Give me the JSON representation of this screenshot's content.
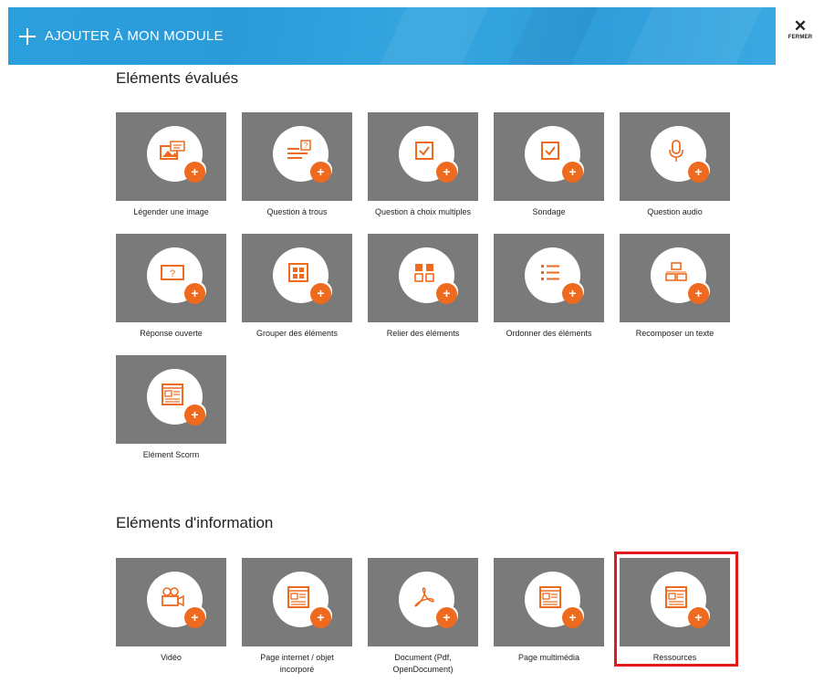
{
  "header": {
    "title": "AJOUTER À MON MODULE"
  },
  "close": {
    "icon": "✕",
    "label": "FERMER"
  },
  "sections": {
    "evaluated": {
      "title": "Eléments évalués",
      "items": [
        {
          "label": "Légender une image",
          "icon": "image-caption-icon"
        },
        {
          "label": "Question à trous",
          "icon": "fill-blank-icon"
        },
        {
          "label": "Question à choix multiples",
          "icon": "checkbox-icon"
        },
        {
          "label": "Sondage",
          "icon": "survey-icon"
        },
        {
          "label": "Question audio",
          "icon": "microphone-icon"
        },
        {
          "label": "Réponse ouverte",
          "icon": "open-answer-icon"
        },
        {
          "label": "Grouper des éléments",
          "icon": "group-icon"
        },
        {
          "label": "Relier des éléments",
          "icon": "link-elements-icon"
        },
        {
          "label": "Ordonner des éléments",
          "icon": "ordered-list-icon"
        },
        {
          "label": "Recomposer un texte",
          "icon": "recompose-text-icon"
        },
        {
          "label": "Elément Scorm",
          "icon": "scorm-icon"
        }
      ]
    },
    "information": {
      "title": "Eléments d'information",
      "items": [
        {
          "label": "Vidéo",
          "icon": "video-camera-icon"
        },
        {
          "label": "Page internet / objet incorporé",
          "icon": "web-page-icon"
        },
        {
          "label": "Document (Pdf, OpenDocument)",
          "icon": "pdf-icon"
        },
        {
          "label": "Page multimédia",
          "icon": "multimedia-page-icon"
        },
        {
          "label": "Ressources",
          "icon": "resources-icon"
        }
      ]
    }
  },
  "badge": "+",
  "colors": {
    "header": "#2b9fdc",
    "tile": "#7a7a7a",
    "accent": "#ee6a1f",
    "selection": "#e11b1b"
  }
}
